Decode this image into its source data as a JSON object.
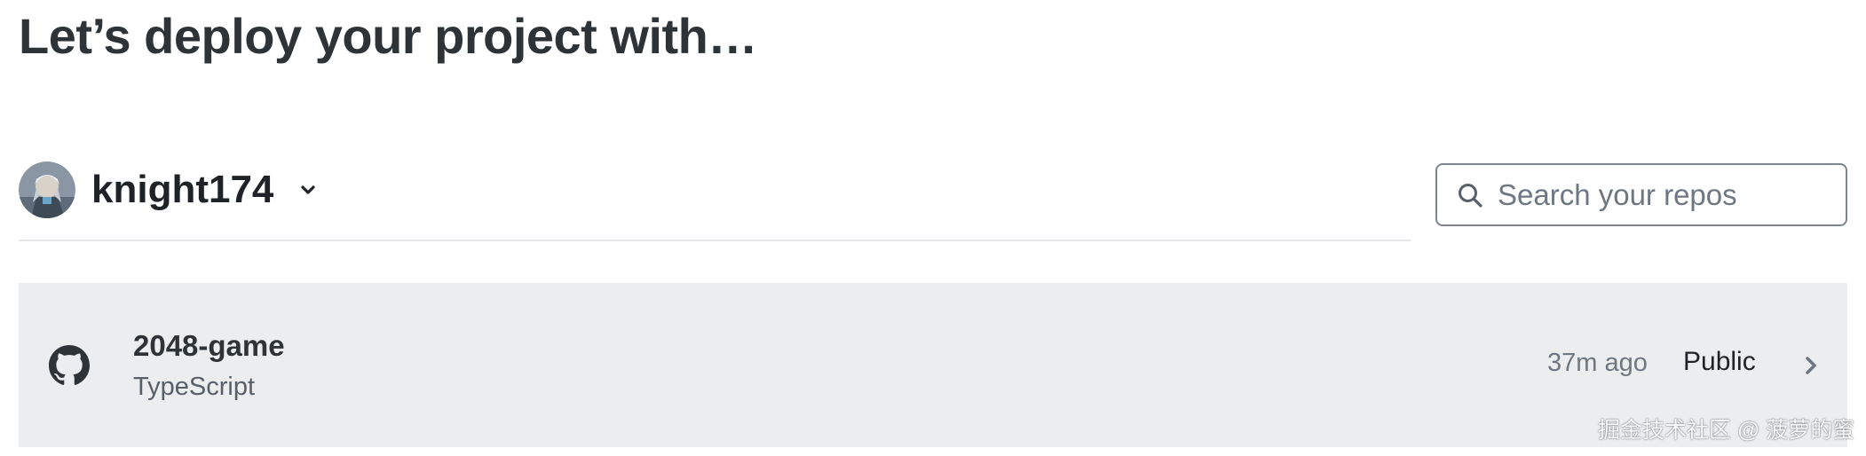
{
  "page": {
    "title": "Let’s deploy your project with…"
  },
  "account": {
    "name": "knight174",
    "avatar_icon": "user-avatar",
    "switch_icon": "chevron-down-icon"
  },
  "search": {
    "placeholder": "Search your repos",
    "value": "",
    "icon": "search-icon"
  },
  "repos": [
    {
      "name": "2048-game",
      "language": "TypeScript",
      "updated": "37m ago",
      "visibility": "Public",
      "icon": "github-icon",
      "action_icon": "chevron-right-icon"
    }
  ],
  "watermark": {
    "text": "掘金技术社区 @ 菠萝的蜜"
  },
  "colors": {
    "text_primary": "#2e3338",
    "row_background": "#ebedef",
    "border": "#7d8590",
    "muted": "#6e7781"
  }
}
